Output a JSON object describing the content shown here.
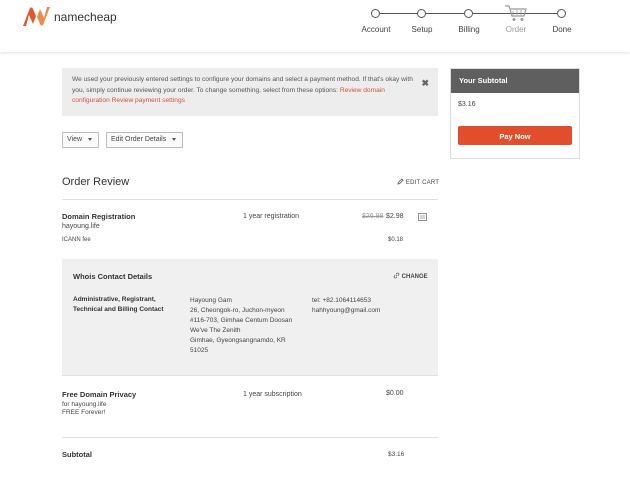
{
  "brand": {
    "name": "namecheap",
    "color": "#e4572e",
    "logo_icon": "namecheap-n-logo"
  },
  "steps": [
    {
      "label": "Account",
      "state": "done"
    },
    {
      "label": "Setup",
      "state": "done"
    },
    {
      "label": "Billing",
      "state": "done"
    },
    {
      "label": "Order",
      "state": "current"
    },
    {
      "label": "Done",
      "state": "todo"
    }
  ],
  "notice": {
    "text": "We used your previously entered settings to configure your domains and select a payment method. If that's okay with you, simply continue reviewing your order. To change something, select from these options: ",
    "link1": "Review domain configuration",
    "link_sep": " ",
    "link2": "Review payment settings",
    "close": "✖"
  },
  "controls": {
    "view_label": "View",
    "edit_details_label": "Edit Order Details"
  },
  "order": {
    "title": "Order Review",
    "edit_cart": "EDIT CART",
    "domain": {
      "name": "Domain Registration",
      "domain": "hayoung.life",
      "term": "1 year registration",
      "old_price": "$26.98",
      "price": "$2.98",
      "fee_label": "ICANN fee",
      "fee_price": "$0.18"
    },
    "whois": {
      "title": "Whois Contact Details",
      "change": "CHANGE",
      "roles": "Administrative, Registrant, Technical and Billing Contact",
      "address": [
        "Hayoung Gam",
        "26, Cheongok-ro, Juchon-myeon",
        "#116-703, Gimhae Centum Doosan",
        "We've The Zenith",
        "Gimhae, Gyeongsangnamdo, KR",
        "51025"
      ],
      "phone": "tel: +82.1064114653",
      "email": "hahhyoung@gmail.com"
    },
    "privacy": {
      "name": "Free Domain Privacy",
      "for": "for hayoung.life",
      "note": "FREE Forever!",
      "term": "1 year subscription",
      "price": "$0.00"
    },
    "subtotal_label": "Subtotal",
    "subtotal_value": "$3.16"
  },
  "sidebar": {
    "title": "Your Subtotal",
    "amount": "$3.16",
    "pay_label": "Pay Now",
    "pay_color": "#e04e2c"
  }
}
